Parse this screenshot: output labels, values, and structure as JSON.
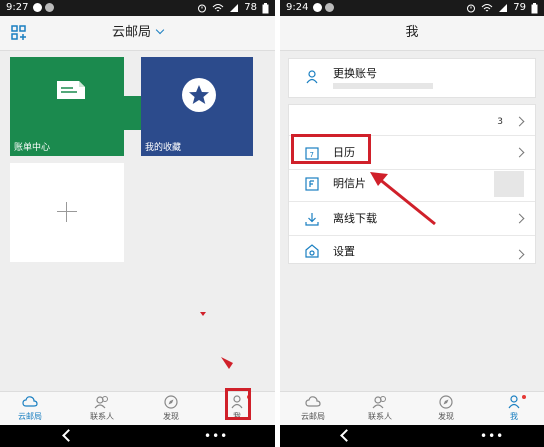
{
  "left": {
    "status": {
      "time": "9:27",
      "battery": "78"
    },
    "title": "云邮局",
    "tiles": [
      {
        "label": "账单中心",
        "icon": "document-icon"
      },
      {
        "label": "我的收藏",
        "icon": "star-icon"
      }
    ],
    "tabs": [
      {
        "label": "云邮局",
        "icon": "cloud-icon",
        "active": true
      },
      {
        "label": "联系人",
        "icon": "contacts-icon",
        "active": false
      },
      {
        "label": "发现",
        "icon": "compass-icon",
        "active": false
      },
      {
        "label": "我",
        "icon": "person-icon",
        "active": false
      }
    ]
  },
  "right": {
    "status": {
      "time": "9:24",
      "battery": "79"
    },
    "title": "我",
    "account": {
      "label": "更换账号",
      "icon": "person-icon"
    },
    "rows": [
      {
        "label": "",
        "count": "3"
      },
      {
        "label": "日历",
        "icon": "calendar-icon"
      },
      {
        "label": "明信片",
        "icon": "postcard-icon"
      },
      {
        "label": "离线下载",
        "icon": "download-icon"
      },
      {
        "label": "设置",
        "icon": "settings-icon"
      }
    ],
    "tabs": [
      {
        "label": "云邮局",
        "icon": "cloud-icon",
        "active": false
      },
      {
        "label": "联系人",
        "icon": "contacts-icon",
        "active": false
      },
      {
        "label": "发现",
        "icon": "compass-icon",
        "active": false
      },
      {
        "label": "我",
        "icon": "person-icon",
        "active": true
      }
    ]
  },
  "colors": {
    "accent": "#1a7fc1",
    "bill_tile": "#1b8a4e",
    "fav_tile": "#2c4b8c",
    "annotation": "#d0202a"
  }
}
